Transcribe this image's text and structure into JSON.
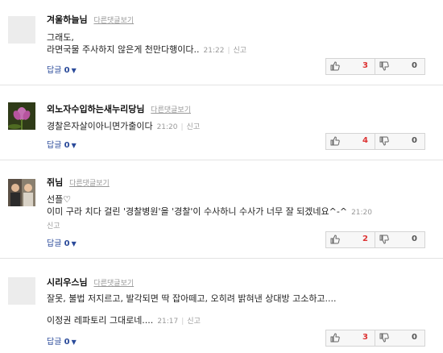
{
  "comments": [
    {
      "author": "겨울하늘님",
      "other_link": "다른댓글보기",
      "lines": [
        "그래도,",
        "라면국물 주사하지 않은게 천만다행이다.."
      ],
      "time": "21:22",
      "report": "신고",
      "reply_label": "답글",
      "reply_count": "0",
      "up": "3",
      "down": "0"
    },
    {
      "author": "외노자수입하는새누리당님",
      "other_link": "다른댓글보기",
      "lines": [
        "경찰은자살이아니면가출이다"
      ],
      "time": "21:20",
      "report": "신고",
      "reply_label": "답글",
      "reply_count": "0",
      "up": "4",
      "down": "0"
    },
    {
      "author": "쥐님",
      "other_link": "다른댓글보기",
      "lines": [
        "선플♡",
        "이미 구라 치다 걸린 '경찰병원'을 '경찰'이 수사하니 수사가 너무 잘 되겠네요^-^"
      ],
      "time": "21:20",
      "report": "신고",
      "reply_label": "답글",
      "reply_count": "0",
      "up": "2",
      "down": "0"
    },
    {
      "author": "시리우스님",
      "other_link": "다른댓글보기",
      "lines": [
        "잘못, 불법 저지르고, 발각되면 딱 잡아떼고, 오히려 밝혀낸 상대방 고소하고....",
        "이정권 레파토리 그대로네...."
      ],
      "time": "21:17",
      "report": "신고",
      "reply_label": "답글",
      "reply_count": "0",
      "up": "3",
      "down": "0"
    }
  ],
  "icons": {
    "up": "thumbs-up-icon",
    "down": "thumbs-down-icon",
    "caret": "caret-down-icon"
  },
  "colors": {
    "reply_link": "#2a4a9a",
    "up_count": "#dd3333",
    "muted": "#999999"
  }
}
